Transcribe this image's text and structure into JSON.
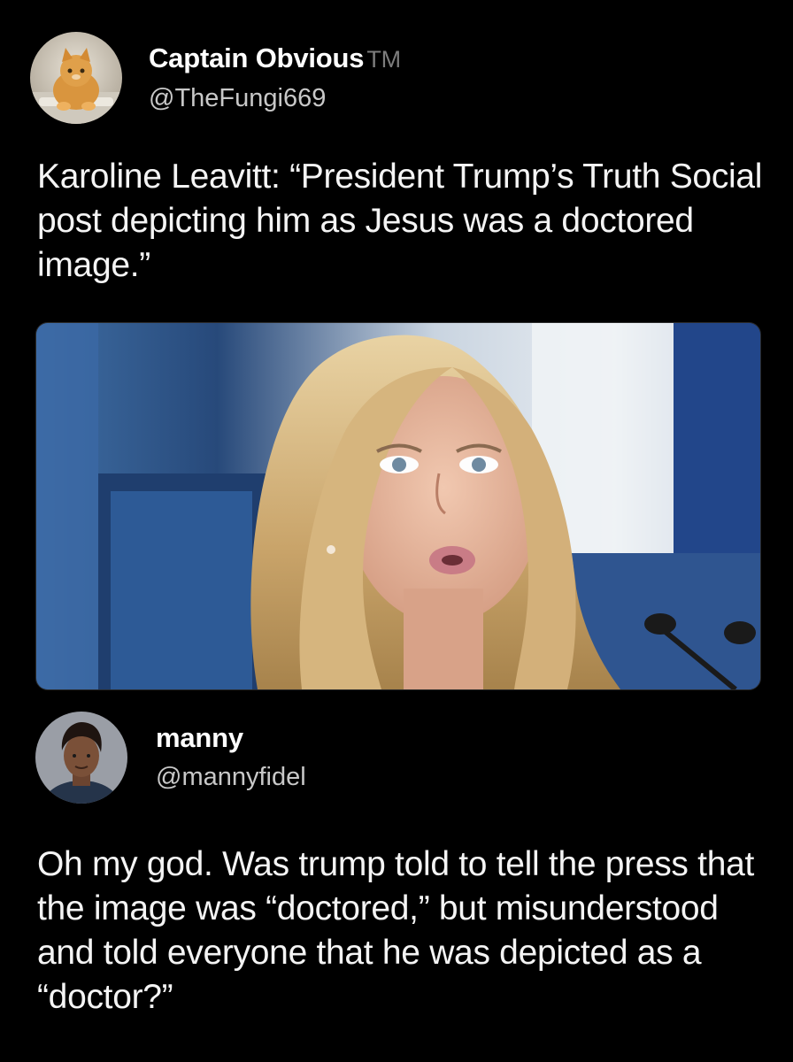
{
  "tweet1": {
    "display_name": "Captain Obvious",
    "display_name_suffix": "TM",
    "handle": "@TheFungi669",
    "text": "Karoline Leavitt: “President Trump’s Truth Social post depicting him as Jesus was a doctored image.”",
    "avatar_icon": "cat-avatar-icon",
    "media_icon": "press-briefing-photo"
  },
  "tweet2": {
    "display_name": "manny",
    "handle": "@mannyfidel",
    "text": "Oh my god. Was trump told to tell the press that the image was “doctored,” but misunderstood and told everyone that he was depicted as a “doctor?”",
    "avatar_icon": "person-avatar-icon"
  },
  "colors": {
    "background": "#000000",
    "text": "#f4f4f4",
    "handle": "#c8c8c8",
    "tm": "#7c7c7c"
  }
}
